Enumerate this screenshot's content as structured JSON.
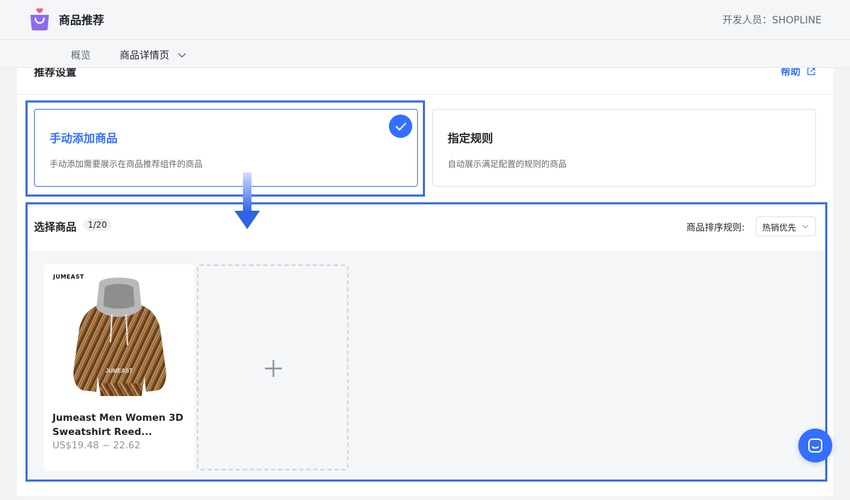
{
  "app": {
    "title": "商品推荐",
    "developer": "开发人员：SHOPLINE",
    "logo_icon": "shopping-bag-heart-icon"
  },
  "nav": {
    "items": [
      {
        "label": "概览"
      },
      {
        "label": "商品详情页"
      }
    ]
  },
  "settings": {
    "title": "推荐设置",
    "help_label": "帮助"
  },
  "options": [
    {
      "title": "手动添加商品",
      "desc": "手动添加需要展示在商品推荐组件的商品",
      "selected": true
    },
    {
      "title": "指定规则",
      "desc": "自动展示满足配置的规则的商品",
      "selected": false
    }
  ],
  "select_products": {
    "title": "选择商品",
    "count": "1/20",
    "sort_label": "商品排序规则:",
    "sort_value": "热销优先"
  },
  "products": [
    {
      "brand": "JUMEAST",
      "name": "Jumeast Men Women 3D Sweatshirt Reed...",
      "price": "US$19.48 ~ 22.62"
    }
  ],
  "colors": {
    "accent": "#3370ff",
    "highlight": "#3a6ee8"
  }
}
